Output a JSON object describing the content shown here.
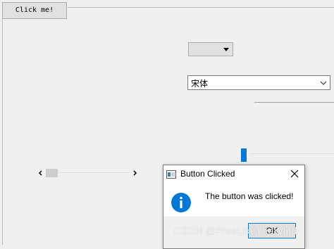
{
  "main": {
    "click_button_label": "Click me!",
    "font_combo_value": "宋体"
  },
  "slider": {
    "value_fraction": 0.0
  },
  "scrollbar": {
    "value_fraction": 0.0
  },
  "dialog": {
    "title": "Button Clicked",
    "message": "The button was clicked!",
    "ok_label": "OK"
  },
  "watermark": {
    "text": "CSDN @FreeLikeTheWind."
  },
  "colors": {
    "accent": "#0078d7",
    "info_icon": "#0078d7"
  }
}
